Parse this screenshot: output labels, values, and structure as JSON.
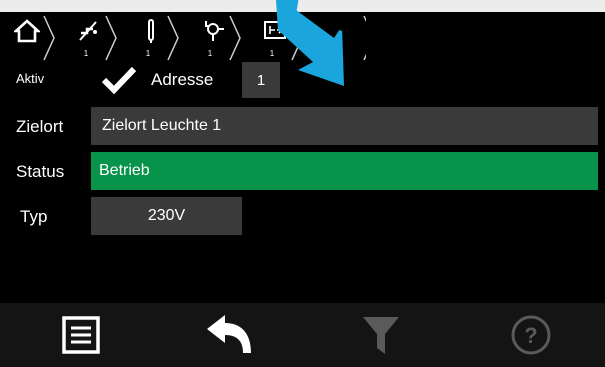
{
  "breadcrumb": [
    {
      "icon": "home-icon",
      "index": ""
    },
    {
      "icon": "signal-off-icon",
      "index": "1"
    },
    {
      "icon": "tube-icon",
      "index": "1"
    },
    {
      "icon": "lamp-icon",
      "index": "1"
    },
    {
      "icon": "exit-sign-icon",
      "index": "1"
    },
    {
      "icon": "empty",
      "index": ""
    }
  ],
  "form": {
    "aktiv_label": "Aktiv",
    "aktiv_checked": true,
    "adresse_label": "Adresse",
    "adresse_value": "1",
    "zielort_label": "Zielort",
    "zielort_value": "Zielort Leuchte 1",
    "status_label": "Status",
    "status_value": "Betrieb",
    "typ_label": "Typ",
    "typ_value": "230V"
  },
  "toolbar": {
    "buttons": [
      {
        "icon": "menu-list-icon",
        "enabled": true
      },
      {
        "icon": "back-arrow-icon",
        "enabled": true
      },
      {
        "icon": "filter-icon",
        "enabled": false
      },
      {
        "icon": "help-icon",
        "enabled": false
      }
    ]
  },
  "colors": {
    "status_ok": "#08934a",
    "field_bg": "#3a3a3a",
    "callout_arrow": "#1aa6dd"
  }
}
